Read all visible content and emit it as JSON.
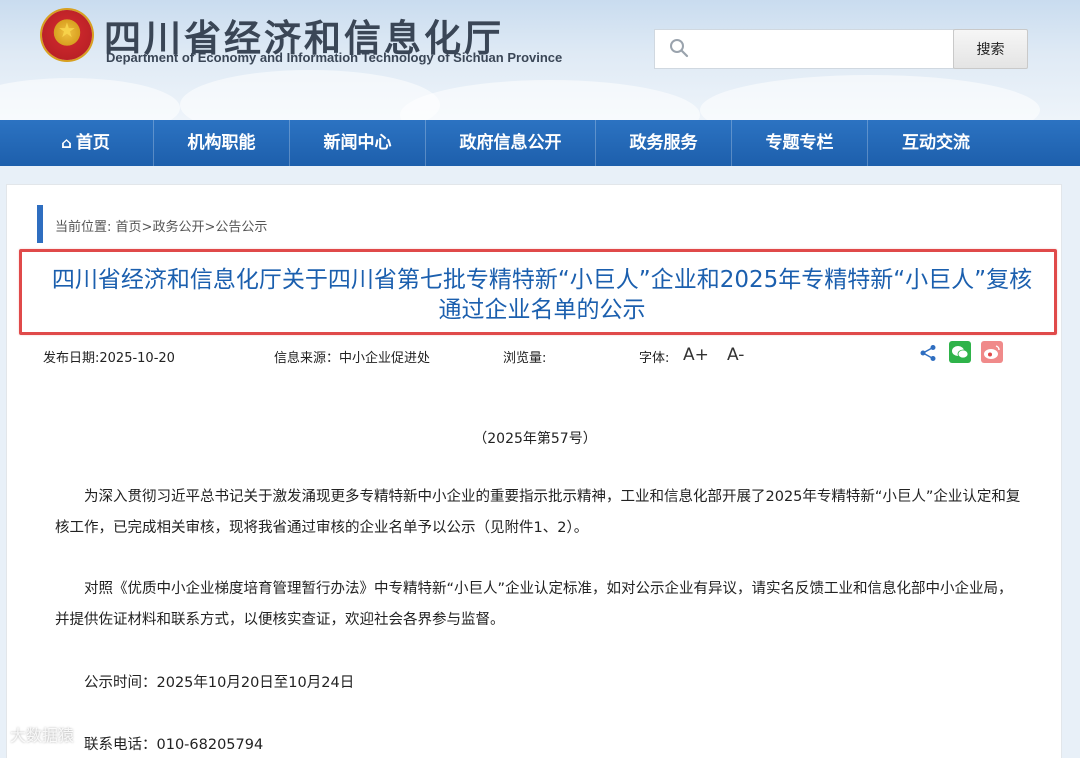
{
  "header": {
    "title": "四川省经济和信息化厅",
    "subtitle": "Department of Economy and Information Technology of Sichuan Province",
    "search": {
      "placeholder": "",
      "button_label": "搜索"
    }
  },
  "nav": {
    "items": [
      {
        "label": "首页",
        "icon": "home-icon"
      },
      {
        "label": "机构职能"
      },
      {
        "label": "新闻中心"
      },
      {
        "label": "政府信息公开"
      },
      {
        "label": "政务服务"
      },
      {
        "label": "专题专栏"
      },
      {
        "label": "互动交流"
      }
    ]
  },
  "breadcrumb": {
    "prefix": "当前位置:",
    "items": [
      "首页",
      "政务公开",
      "公告公示"
    ],
    "separator": ">"
  },
  "article": {
    "title": "四川省经济和信息化厅关于四川省第七批专精特新“小巨人”企业和2025年专精特新“小巨人”复核通过企业名单的公示",
    "publish_date": "发布日期:2025-10-20",
    "source": "信息来源：中小企业促进处",
    "views_label": "浏览量:",
    "font_label": "字体:",
    "font_increase": "A+",
    "font_decrease": "A-",
    "doc_number": "（2025年第57号）",
    "paragraphs": [
      "为深入贯彻习近平总书记关于激发涌现更多专精特新中小企业的重要指示批示精神，工业和信息化部开展了2025年专精特新“小巨人”企业认定和复核工作，已完成相关审核，现将我省通过审核的企业名单予以公示（见附件1、2）。",
      "对照《优质中小企业梯度培育管理暂行办法》中专精特新“小巨人”企业认定标准，如对公示企业有异议，请实名反馈工业和信息化部中小企业局，并提供佐证材料和联系方式，以便核实查证，欢迎社会各界参与监督。"
    ],
    "publicity_period": "公示时间：2025年10月20日至10月24日",
    "contact_phone": "联系电话：010-68205794"
  },
  "watermark": "大数据猿",
  "colors": {
    "nav_blue": "#1d5fac",
    "title_blue": "#1b5fae",
    "highlight_red": "#e04a4a"
  }
}
